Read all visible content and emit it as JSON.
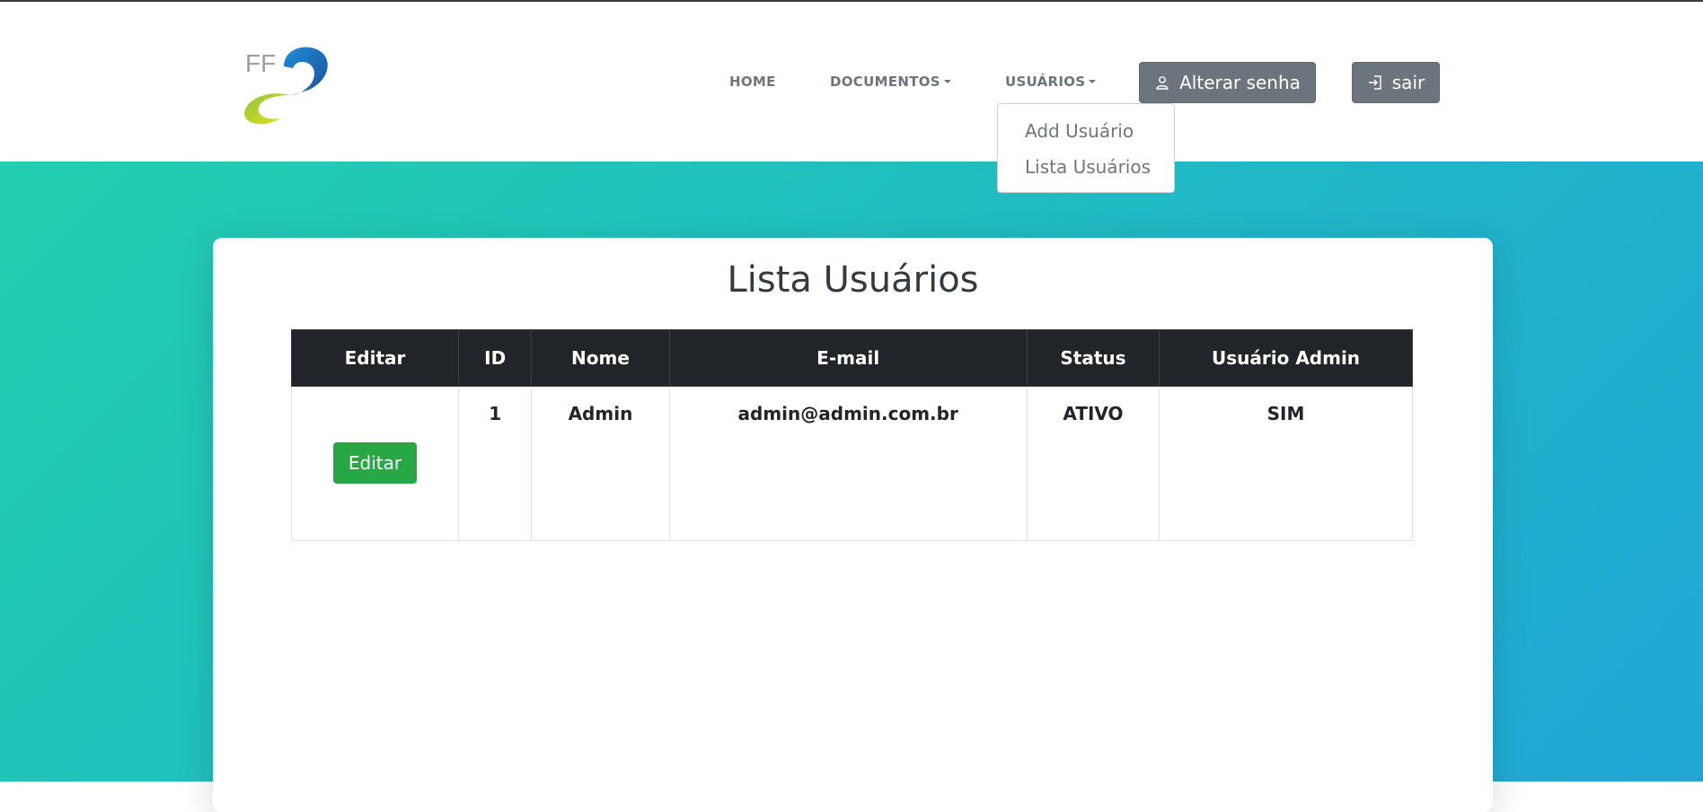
{
  "nav": {
    "home": "HOME",
    "documentos": "DOCUMENTOS",
    "usuarios": "USUÁRIOS",
    "alterar_senha": "Alterar senha",
    "sair": "sair"
  },
  "logo": {
    "text": "FF"
  },
  "dropdown": {
    "items": [
      "Add Usuário",
      "Lista Usuários"
    ]
  },
  "page": {
    "title": "Lista Usuários"
  },
  "table": {
    "headers": [
      "Editar",
      "ID",
      "Nome",
      "E-mail",
      "Status",
      "Usuário Admin"
    ],
    "rows": [
      {
        "edit_label": "Editar",
        "id": "1",
        "nome": "Admin",
        "email": "admin@admin.com.br",
        "status": "ATIVO",
        "admin": "SIM"
      }
    ]
  },
  "colors": {
    "accent_green": "#28a745",
    "header_dark": "#212529",
    "button_gray": "#6c757d",
    "gradient_start": "#22cfae",
    "gradient_end": "#21a6d6"
  },
  "icons": [
    "user-icon",
    "sign-in-icon",
    "chevron-down-icon"
  ]
}
